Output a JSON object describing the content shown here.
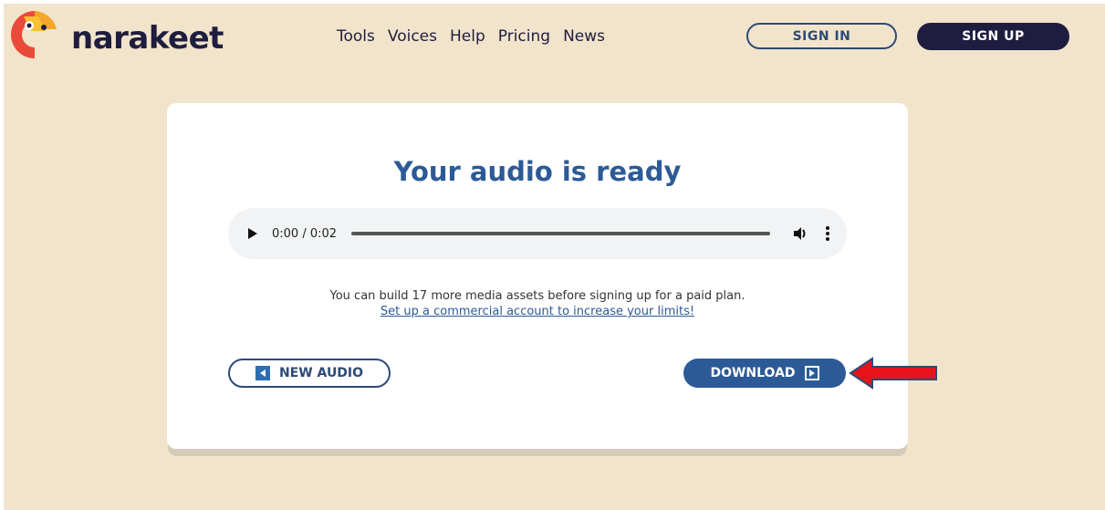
{
  "brand": {
    "name": "narakeet",
    "colors": {
      "navy": "#1f1d3f",
      "blue": "#2c5a96",
      "background": "#f2e4cb"
    }
  },
  "nav": {
    "items": [
      {
        "label": "Tools"
      },
      {
        "label": "Voices"
      },
      {
        "label": "Help"
      },
      {
        "label": "Pricing"
      },
      {
        "label": "News"
      }
    ]
  },
  "header": {
    "sign_in_label": "SIGN IN",
    "sign_up_label": "SIGN UP"
  },
  "card": {
    "title": "Your audio is ready",
    "player": {
      "time": "0:00 / 0:02",
      "progress": 0
    },
    "info_text": "You can build 17 more media assets before signing up for a paid plan.",
    "info_link": "Set up a commercial account to increase your limits!",
    "new_audio_label": "NEW AUDIO",
    "download_label": "DOWNLOAD"
  },
  "annotation": {
    "arrow_color": "#e8141b",
    "arrow_outline": "#2c4a77"
  }
}
